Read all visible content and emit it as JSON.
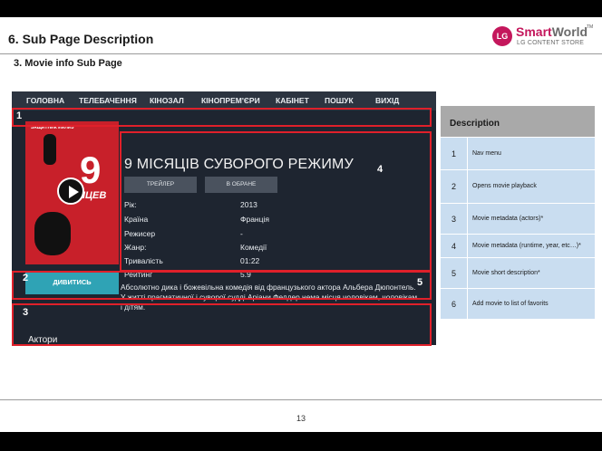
{
  "header": {
    "title": "6. Sub Page Description",
    "subtitle": "3. Movie info Sub Page",
    "logo_lg": "LG",
    "logo_smart": "Smart",
    "logo_world": "World",
    "logo_tm": "TM",
    "logo_sub": "LG CONTENT STORE"
  },
  "nav": {
    "items": [
      "ГОЛОВНА",
      "ТЕЛЕБАЧЕННЯ",
      "КІНОЗАЛ",
      "КІНОПРЕМ'ЄРИ",
      "КАБІНЕТ",
      "ПОШУК",
      "ВИХІД"
    ]
  },
  "movie": {
    "title": "9 МІСЯЦІВ СУВОРОГО РЕЖИМУ",
    "trailer_button": "ТРЕЙЛЕР",
    "favorite_button": "В ОБРАНЕ",
    "watch_button": "ДИВИТИСЬ",
    "poster_header": "ЗАЩИТНИК ИИЛИЗ",
    "poster_number": "9",
    "poster_word": "СЯЦЕВ",
    "metadata": [
      {
        "label": "Рік:",
        "value": "2013"
      },
      {
        "label": "Країна",
        "value": "Франція"
      },
      {
        "label": "Режисер",
        "value": "-"
      },
      {
        "label": "Жанр:",
        "value": "Комедії"
      },
      {
        "label": "Тривалість",
        "value": "01:22"
      },
      {
        "label": "Рейтинг",
        "value": "5.9"
      }
    ],
    "description": "Абсолютно дика і божевільна комедія від французького актора Альбера Дюпонтель. У житті прагматичної і суворої судді Аріани Фелдер нема місця чоловікам, чоловікам і дітям.",
    "actors_label": "Актори"
  },
  "callouts": [
    "1",
    "2",
    "3",
    "4",
    "5"
  ],
  "table": {
    "header": "Description",
    "rows": [
      {
        "num": "1",
        "text": "Nav menu"
      },
      {
        "num": "2",
        "text": "Opens movie playback"
      },
      {
        "num": "3",
        "text": "Movie metadata (actors)*"
      },
      {
        "num": "4",
        "text": "Movie metadata (runtime, year, etc…)*"
      },
      {
        "num": "5",
        "text": "Movie short description*"
      },
      {
        "num": "6",
        "text": "Add movie to list of favorits"
      }
    ]
  },
  "footer": {
    "page_number": "13"
  },
  "colors": {
    "accent": "#c4175c",
    "highlight": "#e0202a",
    "watch": "#2fa3b5",
    "table_row": "#c9ddf0"
  }
}
